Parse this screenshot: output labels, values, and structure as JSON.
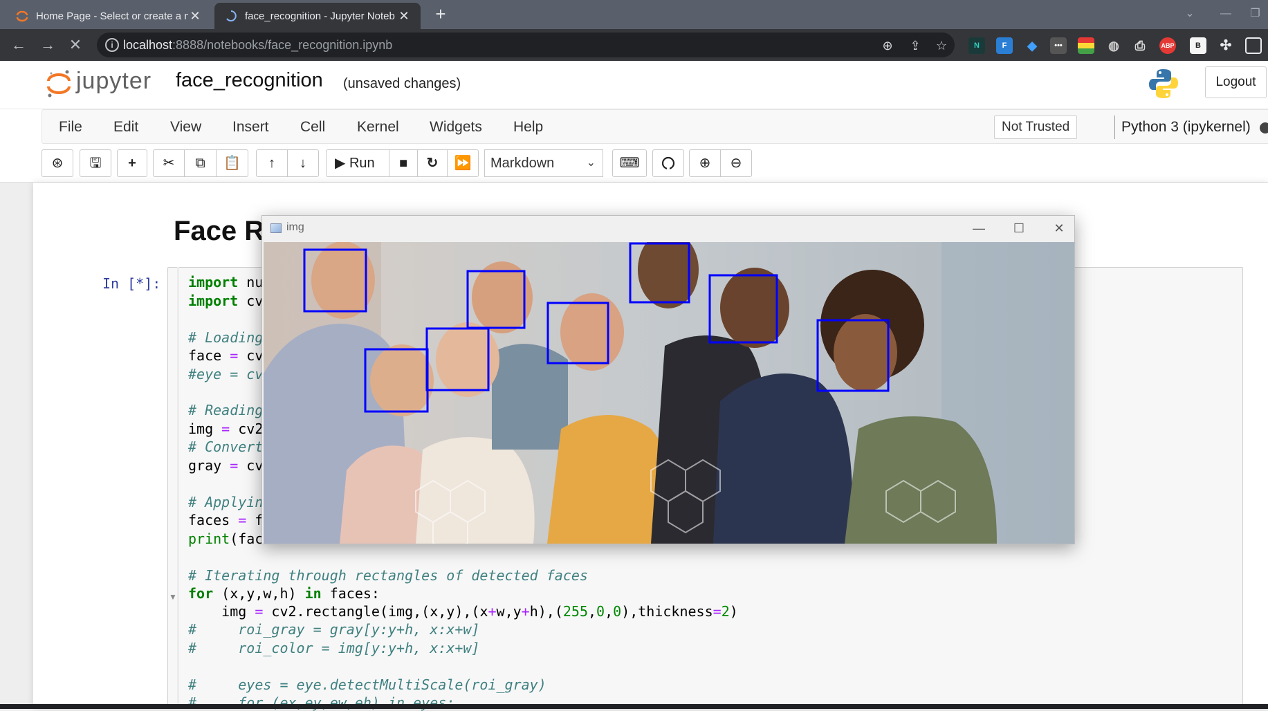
{
  "browser": {
    "tabs": [
      {
        "title": "Home Page - Select or create a n",
        "active": false
      },
      {
        "title": "face_recognition - Jupyter Noteb",
        "active": true
      }
    ],
    "url_host": "localhost",
    "url_path": ":8888/notebooks/face_recognition.ipynb"
  },
  "jupyter": {
    "logo_text": "jupyter",
    "notebook_name": "face_recognition",
    "save_status": "(unsaved changes)",
    "logout_label": "Logout",
    "menu": [
      "File",
      "Edit",
      "View",
      "Insert",
      "Cell",
      "Kernel",
      "Widgets",
      "Help"
    ],
    "trust_status": "Not Trusted",
    "kernel": "Python 3 (ipykernel)",
    "toolbar": {
      "run_label": "Run",
      "cell_type": "Markdown"
    }
  },
  "notebook": {
    "heading": "Face R",
    "prompt": "In [*]:",
    "code_lines": [
      "import nu",
      "import cv",
      "",
      "# Loading",
      "face = cv",
      "#eye = cv",
      "",
      "# Reading",
      "img = cv2",
      "# Convert",
      "gray = cv",
      "",
      "# Applyin",
      "faces = f",
      "print(fac",
      "",
      "# Iterating through rectangles of detected faces",
      "for (x,y,w,h) in faces:",
      "    img = cv2.rectangle(img,(x,y),(x+w,y+h),(255,0,0),thickness=2)",
      "#     roi_gray = gray[y:y+h, x:x+w]",
      "#     roi_color = img[y:y+h, x:x+w]",
      "",
      "#     eyes = eye.detectMultiScale(roi_gray)",
      "#     for (ex,ey,ew,eh) in eyes:"
    ]
  },
  "image_window": {
    "title": "img",
    "detected_faces": 8,
    "box_color": "#0000ff"
  }
}
